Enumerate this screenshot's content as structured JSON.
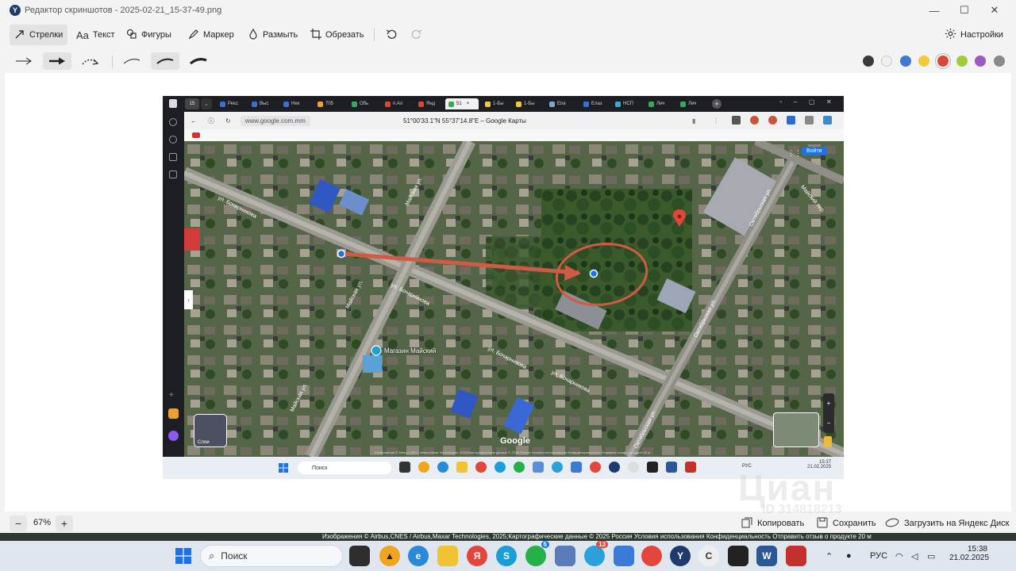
{
  "window": {
    "title": "Редактор скриншотов - 2025-02-21_15-37-49.png",
    "app_logo_letter": "Y",
    "minimize": "—",
    "maximize": "☐",
    "close": "✕"
  },
  "toolbar": {
    "tools": [
      {
        "id": "arrows",
        "label": "Стрелки",
        "icon": "arrow-draw-icon",
        "active": true
      },
      {
        "id": "text",
        "label": "Текст",
        "icon": "text-icon",
        "active": false
      },
      {
        "id": "shapes",
        "label": "Фигуры",
        "icon": "shapes-icon",
        "active": false
      },
      {
        "id": "marker",
        "label": "Маркер",
        "icon": "marker-icon",
        "active": false
      },
      {
        "id": "blur",
        "label": "Размыть",
        "icon": "blur-drop-icon",
        "active": false
      },
      {
        "id": "crop",
        "label": "Обрезать",
        "icon": "crop-icon",
        "active": false
      }
    ],
    "text_icon_glyph": "Aa",
    "undo_icon": "undo-icon",
    "redo_icon": "redo-icon",
    "settings_label": "Настройки"
  },
  "arrow_styles": [
    "thin-arrow",
    "bold-arrow",
    "dotted-curved-arrow",
    "thin-curve",
    "medium-curve",
    "thick-curve"
  ],
  "selected_arrow_style": "bold-arrow",
  "colors": [
    {
      "name": "black",
      "hex": "#3a3a3a"
    },
    {
      "name": "white",
      "hex": "#f0f0f0"
    },
    {
      "name": "blue",
      "hex": "#3d7ad6"
    },
    {
      "name": "yellow",
      "hex": "#f1c93b"
    },
    {
      "name": "red",
      "hex": "#d6493a",
      "selected": true
    },
    {
      "name": "green",
      "hex": "#a4c93a"
    },
    {
      "name": "purple",
      "hex": "#9a5bc2"
    },
    {
      "name": "gray",
      "hex": "#8a8a8a"
    }
  ],
  "footer": {
    "zoom_minus": "−",
    "zoom_level": "67%",
    "zoom_plus": "+",
    "copy_label": "Копировать",
    "save_label": "Сохранить",
    "upload_label": "Загрузить на Яндекс Диск"
  },
  "screenshot": {
    "address_url": "www.google.com.mm",
    "page_title": "51°00'33.1\"N 55°37'14.8\"E – Google Карты",
    "tabs": [
      "Реєс",
      "Выс",
      "Нек",
      "705",
      "Обь",
      "п.Ал",
      "Янд",
      "51",
      "1-Бы",
      "1-Бы",
      "Епа",
      "Елаз",
      "НСП",
      "Лич",
      "Лич"
    ],
    "tab_count": "15",
    "login_button": "Войти",
    "google_logo": "Google",
    "layers_label": "Слои",
    "store_label": "Магазин Майский",
    "streets": [
      "ул. Бочарникова",
      "ул. Бочарникова",
      "ул. Бочарникова",
      "ул. Бочарникова",
      "Майская ул.",
      "Майская ул.",
      "Майская ул.",
      "Октябрьская ул.",
      "Октябрьская ул.",
      "Октябрьская ул.",
      "Майский пер."
    ],
    "attribution": "Изображения © Airbus,CNES / Airbus,Maxar Technologies, 2025;Картографические данные ©, 2025   Россия   Условия использования   Конфиденциальность   Отправить отзыв о продукте   20 м",
    "taskbar": {
      "search_label": "Поиск",
      "lang": "РУС",
      "time": "15:37",
      "date": "21.02.2025"
    }
  },
  "background_attribution": "Изображения © Airbus,CNES / Airbus,Maxar Technologies, 2025;Картографические данные © 2025   Россия   Условия использования   Конфиденциальность   Отправить отзыв о продукте   20 м",
  "watermark": {
    "brand": "Циан",
    "code": "ID 314818213"
  },
  "taskbar": {
    "search_label": "Поиск",
    "lang": "РУС",
    "time": "15:38",
    "date": "21.02.2025",
    "whatsapp_badge": "6",
    "telegram_badge": "13"
  }
}
